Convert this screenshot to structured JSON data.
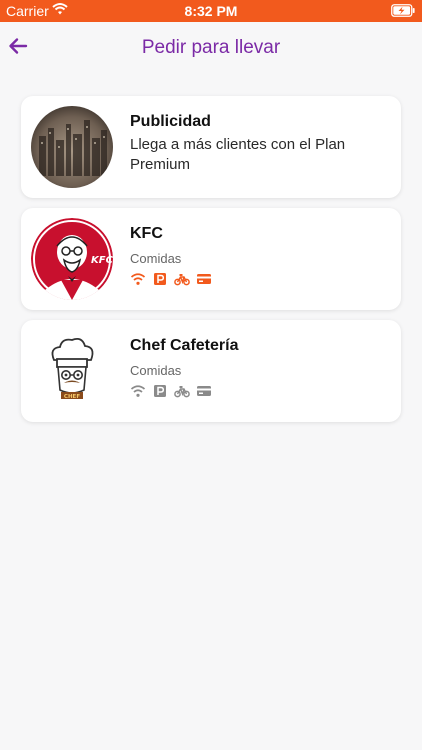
{
  "status_bar": {
    "carrier": "Carrier",
    "time": "8:32 PM"
  },
  "header": {
    "title": "Pedir para llevar",
    "back_icon": "arrow-left-icon"
  },
  "colors": {
    "status_bar": "#f25a1d",
    "accent": "#7b2aa6",
    "active_service": "#f25a1d",
    "inactive_service": "#8a8a8a"
  },
  "cards": [
    {
      "title": "Publicidad",
      "description": "Llega a más clientes con el Plan Premium"
    },
    {
      "title": "KFC",
      "category": "Comidas",
      "services_active": true,
      "services": [
        "wifi-icon",
        "parking-icon",
        "delivery-bike-icon",
        "card-payment-icon"
      ]
    },
    {
      "title": "Chef Cafetería",
      "category": "Comidas",
      "services_active": false,
      "services": [
        "wifi-icon",
        "parking-icon",
        "delivery-bike-icon",
        "card-payment-icon"
      ],
      "logo_text": "CHEF"
    }
  ]
}
